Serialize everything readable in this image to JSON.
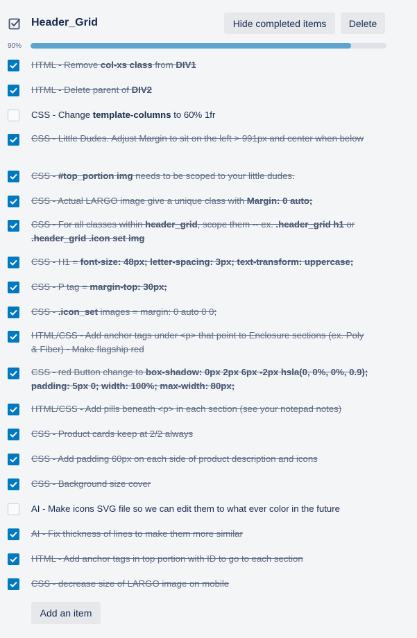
{
  "checklist": {
    "title": "Header_Grid",
    "hide_completed_label": "Hide completed items",
    "delete_label": "Delete",
    "progress_label": "90%",
    "progress_value": 90,
    "add_item_label": "Add an item",
    "accent_color": "#0079bf",
    "progress_color": "#5ba4cf",
    "items": [
      {
        "checked": true,
        "parts": [
          {
            "t": "HTML - Remove "
          },
          {
            "t": "col-xs class",
            "b": true
          },
          {
            "t": " from "
          },
          {
            "t": "DIV1",
            "b": true
          }
        ]
      },
      {
        "checked": true,
        "parts": [
          {
            "t": "HTML - Delete parent of "
          },
          {
            "t": "DIV2",
            "b": true
          }
        ]
      },
      {
        "checked": false,
        "parts": [
          {
            "t": "CSS - Change "
          },
          {
            "t": "template-columns",
            "b": true
          },
          {
            "t": " to 60% 1fr"
          }
        ]
      },
      {
        "checked": true,
        "parts": [
          {
            "t": "CSS - Little Dudes. Adjust Margin to sit on the left > 991px and center when below"
          }
        ]
      },
      {
        "checked": true,
        "parts": [
          {
            "t": "CSS - "
          },
          {
            "t": "#top_portion img",
            "b": true
          },
          {
            "t": " needs to be scoped to your little dudes."
          }
        ]
      },
      {
        "checked": true,
        "parts": [
          {
            "t": "CSS - Actual LARGO image give a unique class with "
          },
          {
            "t": "Margin: 0 auto;",
            "b": true
          }
        ]
      },
      {
        "checked": true,
        "parts": [
          {
            "t": "CSS - For all classes within "
          },
          {
            "t": "header_grid",
            "b": true
          },
          {
            "t": ", scope them -- ex. "
          },
          {
            "t": ".header_grid h1",
            "b": true
          },
          {
            "t": " or "
          },
          {
            "t": ".header_grid .icon set img",
            "b": true
          }
        ]
      },
      {
        "checked": true,
        "parts": [
          {
            "t": "CSS - H1 = "
          },
          {
            "t": "font-size: 48px; letter-spacing: 3px; text-transform: uppercase;",
            "b": true
          }
        ]
      },
      {
        "checked": true,
        "parts": [
          {
            "t": "CSS - P tag = "
          },
          {
            "t": "margin-top: 30px;",
            "b": true
          }
        ]
      },
      {
        "checked": true,
        "parts": [
          {
            "t": "CSS - "
          },
          {
            "t": ".icon_set",
            "b": true
          },
          {
            "t": " images = margin: 0 auto 0 0;"
          }
        ]
      },
      {
        "checked": true,
        "parts": [
          {
            "t": "HTML/CSS - Add anchor tags under <p> that point to Enclosure sections (ex. Poly & Fiber) - Make flagship red"
          }
        ]
      },
      {
        "checked": true,
        "parts": [
          {
            "t": "CSS - red Button change to "
          },
          {
            "t": "box-shadow: 0px 2px 6px -2px hsla(0, 0%, 0%, 0.9); padding: 5px 0; width: 100%; max-width: 80px;",
            "b": true
          }
        ]
      },
      {
        "checked": true,
        "parts": [
          {
            "t": "HTML/CSS - Add pills beneath <p> in each section (see your notepad notes)"
          }
        ]
      },
      {
        "checked": true,
        "parts": [
          {
            "t": "CSS - Product cards keep at 2/2 always"
          }
        ]
      },
      {
        "checked": true,
        "parts": [
          {
            "t": "CSS - Add padding 60px on each side of product description and icons"
          }
        ]
      },
      {
        "checked": true,
        "parts": [
          {
            "t": "CSS - Background size cover"
          }
        ]
      },
      {
        "checked": false,
        "parts": [
          {
            "t": "AI - Make icons SVG file so we can edit them to what ever color in the future"
          }
        ]
      },
      {
        "checked": true,
        "parts": [
          {
            "t": "AI - Fix thickness of lines to make them more similar"
          }
        ]
      },
      {
        "checked": true,
        "parts": [
          {
            "t": "HTML - Add anchor tags in top portion with ID to go to each section"
          }
        ]
      },
      {
        "checked": true,
        "parts": [
          {
            "t": "CSS - decrease size of LARGO image on mobile"
          }
        ]
      }
    ]
  }
}
